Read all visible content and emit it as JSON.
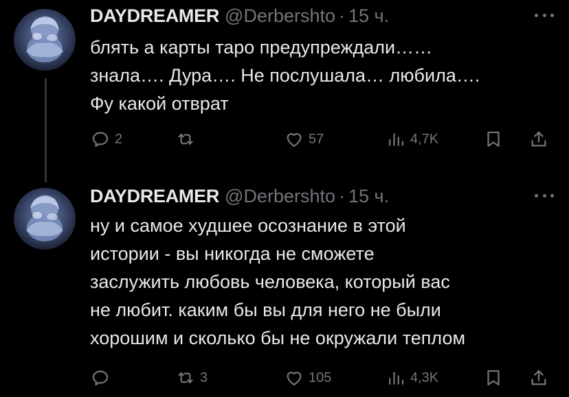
{
  "colors": {
    "background": "#000000",
    "text": "#e7e9ea",
    "muted": "#71767b",
    "thread_line": "#333639"
  },
  "tweets": [
    {
      "display_name": "DAYDREAMER",
      "handle": "@Derbershto",
      "separator": "·",
      "time": "15 ч.",
      "text": "блять а карты таро предупреждали……\nзнала…. Дура…. Не послушала… любила….\nФу какой отврат",
      "actions": {
        "replies": "2",
        "retweets": "",
        "likes": "57",
        "views": "4,7K"
      },
      "icons": [
        "reply-icon",
        "retweet-icon",
        "like-icon",
        "views-icon",
        "bookmark-icon",
        "share-icon",
        "more-icon"
      ]
    },
    {
      "display_name": "DAYDREAMER",
      "handle": "@Derbershto",
      "separator": "·",
      "time": "15 ч.",
      "text": "ну и самое худшее осознание в этой\nистории - вы никогда не сможете\nзаслужить любовь человека, который вас\nне любит. каким бы вы для него не были\nхорошим и сколько бы не окружали теплом",
      "actions": {
        "replies": "",
        "retweets": "3",
        "likes": "105",
        "views": "4,3K"
      },
      "icons": [
        "reply-icon",
        "retweet-icon",
        "like-icon",
        "views-icon",
        "bookmark-icon",
        "share-icon",
        "more-icon"
      ]
    }
  ]
}
